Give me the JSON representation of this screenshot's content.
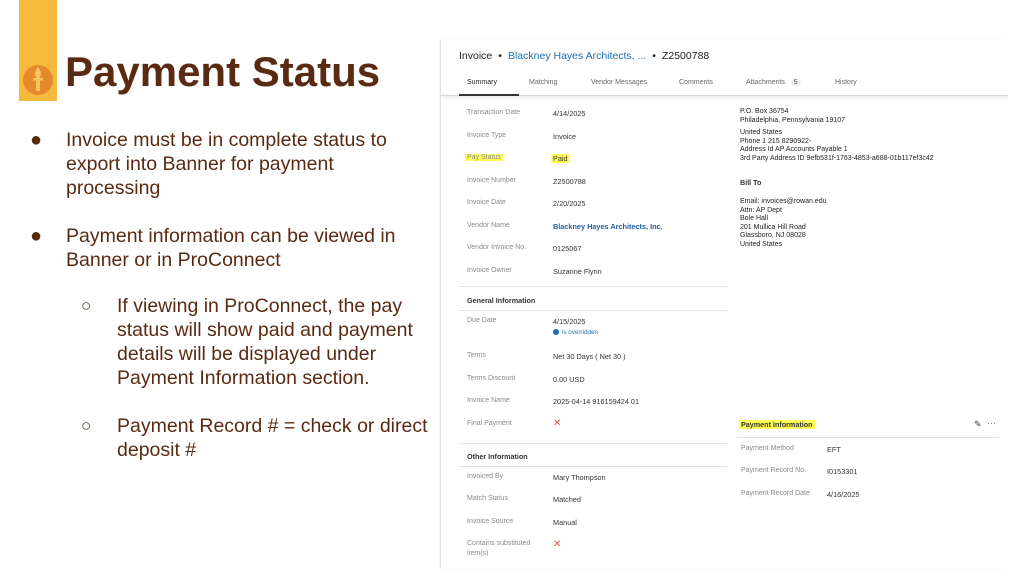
{
  "slide": {
    "title": "Payment Status",
    "bullets": [
      "Invoice must be in complete status to export into Banner for payment processing",
      "Payment information can be viewed in Banner or in ProConnect"
    ],
    "sub_bullets": [
      "If viewing in ProConnect, the pay status will show paid and payment details will be displayed under Payment Information section.",
      "Payment Record # = check or direct deposit #"
    ],
    "colors": {
      "title": "#5a2a12",
      "accent_bar": "#f6b93b",
      "highlight": "#ffff57"
    }
  },
  "screenshot": {
    "breadcrumb": {
      "root": "Invoice",
      "vendor": "Blackney Hayes Architects, ...",
      "number": "Z2500788"
    },
    "tabs": [
      "Summary",
      "Matching",
      "Vendor Messages",
      "Comments",
      "Attachments",
      "History"
    ],
    "attachments_count": "5",
    "fields": [
      {
        "label": "Transaction Date",
        "value": "4/14/2025"
      },
      {
        "label": "Invoice Type",
        "value": "Invoice"
      },
      {
        "label": "Pay Status",
        "value": "Paid"
      },
      {
        "label": "Invoice Number",
        "value": "Z2500788"
      },
      {
        "label": "Invoice Date",
        "value": "2/20/2025"
      },
      {
        "label": "Vendor Name",
        "value": "Blackney Hayes Architects, Inc."
      },
      {
        "label": "Vendor Invoice No.",
        "value": "0125067"
      },
      {
        "label": "Invoice Owner",
        "value": "Suzanne Flynn"
      }
    ],
    "general_heading": "General Information",
    "general": [
      {
        "label": "Due Date",
        "value": "4/15/2025"
      },
      {
        "label": "Terms",
        "value": "Net 30 Days ( Net 30 )"
      },
      {
        "label": "Terms Discount",
        "value": "0.00 USD"
      },
      {
        "label": "Invoice Name",
        "value": "2025-04-14 916159424 01"
      },
      {
        "label": "Final Payment",
        "value": ""
      }
    ],
    "is_overridden": "is overridden",
    "other_heading": "Other Information",
    "other": [
      {
        "label": "Invoiced By",
        "value": "Mary Thompson"
      },
      {
        "label": "Match Status",
        "value": "Matched"
      },
      {
        "label": "Invoice Source",
        "value": "Manual"
      },
      {
        "label": "Contains substituted",
        "value": ""
      }
    ],
    "contains_label_2": "item(s)",
    "remit_to": [
      "P.O. Box 36754",
      "Philadelphia, Pennsylvania 19107",
      "",
      "United States",
      "Phone 1 215 8290922-",
      "Address Id AP Accounts Payable 1",
      "3rd Party Address ID 9efb531f-1763-4853-a688-01b117ef3c42"
    ],
    "bill_to_heading": "Bill To",
    "bill_to": [
      "Email: invoices@rowan.edu",
      "Attn: AP Dept",
      "Bole Hall",
      "201 Mullica Hill Road",
      "Glassboro, NJ 08028",
      "United States"
    ],
    "payment_heading": "Payment Information",
    "payment": [
      {
        "label": "Payment Method",
        "value": "EFT"
      },
      {
        "label": "Payment Record No.",
        "value": "I0153301"
      },
      {
        "label": "Payment Record Date",
        "value": "4/16/2025"
      }
    ],
    "icons": {
      "edit": "pencil-icon",
      "more": "more-options-icon",
      "false_mark": "x-mark-icon"
    }
  }
}
